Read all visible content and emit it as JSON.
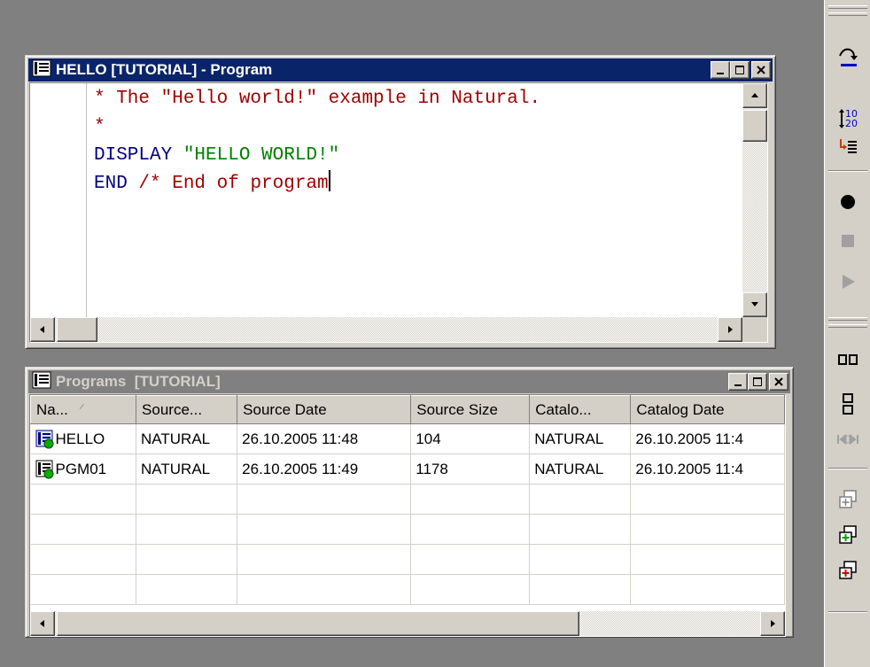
{
  "editor_window": {
    "title": "HELLO [TUTORIAL] - Program",
    "code": [
      {
        "text": "* The \"Hello world!\" example in Natural.",
        "kind": "comment"
      },
      {
        "text": "*",
        "kind": "comment"
      },
      {
        "text": "DISPLAY \"HELLO WORLD!\"",
        "kind": "mixed_display"
      },
      {
        "text": "END /* End of program",
        "kind": "mixed_end"
      }
    ],
    "tokens": {
      "display_kw": "DISPLAY ",
      "display_str": "\"HELLO WORLD!\"",
      "end_kw": "END ",
      "end_comment": "/* End of program"
    }
  },
  "programs_window": {
    "title": "Programs  [TUTORIAL]",
    "columns": [
      "Na...",
      "Source...",
      "Source Date",
      "Source Size",
      "Catalo...",
      "Catalog Date"
    ],
    "rows": [
      {
        "name": "HELLO",
        "source": "NATURAL",
        "source_date": "26.10.2005 11:48",
        "source_size": "104",
        "catalog": "NATURAL",
        "catalog_date": "26.10.2005 11:4"
      },
      {
        "name": "PGM01",
        "source": "NATURAL",
        "source_date": "26.10.2005 11:49",
        "source_size": "1178",
        "catalog": "NATURAL",
        "catalog_date": "26.10.2005 11:4"
      }
    ]
  },
  "colors": {
    "active_title": "#0a246a",
    "inactive_title": "#808080",
    "comment": "#a00000",
    "keyword": "#000080",
    "string": "#008000"
  },
  "toolbar_icons": [
    "step-over-icon",
    "line-numbers-icon",
    "step-into-icon",
    "breakpoint-icon",
    "stop-icon",
    "run-icon",
    "tile-horizontal-icon",
    "tile-vertical-icon",
    "arrange-icon",
    "new-window-icon",
    "cascade-icon",
    "new-window-plus-icon"
  ],
  "toolbar": {
    "line_numbers_top": "10",
    "line_numbers_bottom": "20"
  }
}
